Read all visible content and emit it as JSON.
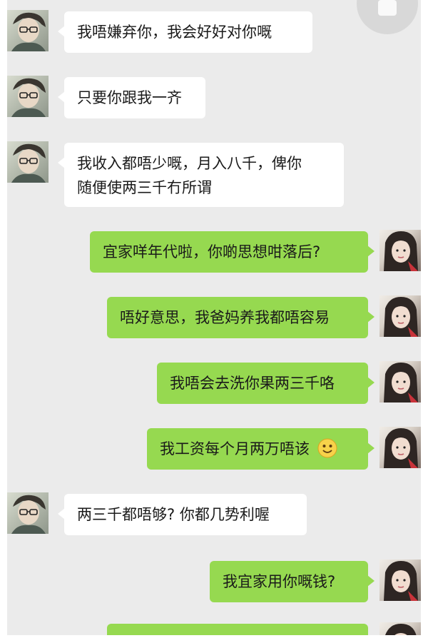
{
  "colors": {
    "chat_background": "#ebebeb",
    "incoming_bubble": "#ffffff",
    "outgoing_bubble": "#96d950",
    "text": "#1a1a1a"
  },
  "messages": [
    {
      "side": "incoming",
      "avatar": "boy-avatar",
      "text": "我唔嫌弃你，我会好好对你嘅"
    },
    {
      "side": "incoming",
      "avatar": "boy-avatar",
      "text": "只要你跟我一齐"
    },
    {
      "side": "incoming",
      "avatar": "boy-avatar",
      "line1": "我收入都唔少嘅，月入八千，俾你",
      "line2": "随便使两三千冇所谓"
    },
    {
      "side": "outgoing",
      "avatar": "girl-avatar",
      "text": "宜家咩年代啦，你啲思想咁落后?"
    },
    {
      "side": "outgoing",
      "avatar": "girl-avatar",
      "text": "唔好意思，我爸妈养我都唔容易"
    },
    {
      "side": "outgoing",
      "avatar": "girl-avatar",
      "text": "我唔会去洗你果两三千咯"
    },
    {
      "side": "outgoing",
      "avatar": "girl-avatar",
      "text": "我工资每个月两万唔该",
      "emoji": "smiley-emoji"
    },
    {
      "side": "incoming",
      "avatar": "boy-avatar",
      "text": "两三千都唔够? 你都几势利喔"
    },
    {
      "side": "outgoing",
      "avatar": "girl-avatar",
      "text": "我宜家用你嘅钱?"
    },
    {
      "side": "outgoing",
      "avatar": "girl-avatar",
      "text": ""
    }
  ]
}
